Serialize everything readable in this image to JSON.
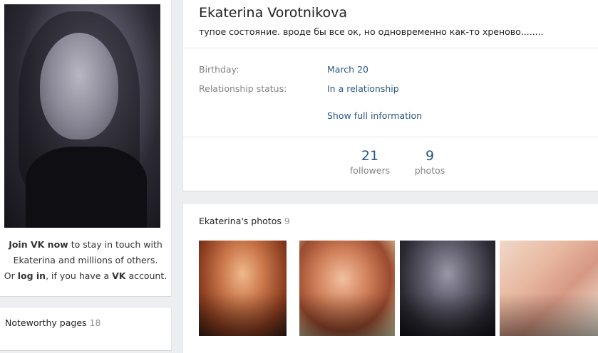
{
  "profile": {
    "name": "Ekaterina Vorotnikova",
    "status": "тупое состояние. вроде бы все ок, но одновременно как-то хреново........"
  },
  "info": {
    "birthday_label": "Birthday:",
    "birthday_value": "March 20",
    "relationship_label": "Relationship status:",
    "relationship_value": "In a relationship",
    "show_full": "Show full information"
  },
  "counters": {
    "followers_num": "21",
    "followers_label": "followers",
    "photos_num": "9",
    "photos_label": "photos"
  },
  "join": {
    "join_link": "Join VK now",
    "line1_rest": " to stay in touch with",
    "line2": "Ekaterina and millions of others.",
    "or": "Or ",
    "login_link": "log in",
    "line3_mid": ", if you have a ",
    "vk": "VK",
    "line3_end": " account."
  },
  "noteworthy": {
    "title": "Noteworthy pages",
    "count": "18"
  },
  "photos": {
    "title": "Ekaterina's photos",
    "count": "9"
  },
  "colors": {
    "link": "#2a5885",
    "muted": "#828282",
    "background": "#edeef0"
  }
}
